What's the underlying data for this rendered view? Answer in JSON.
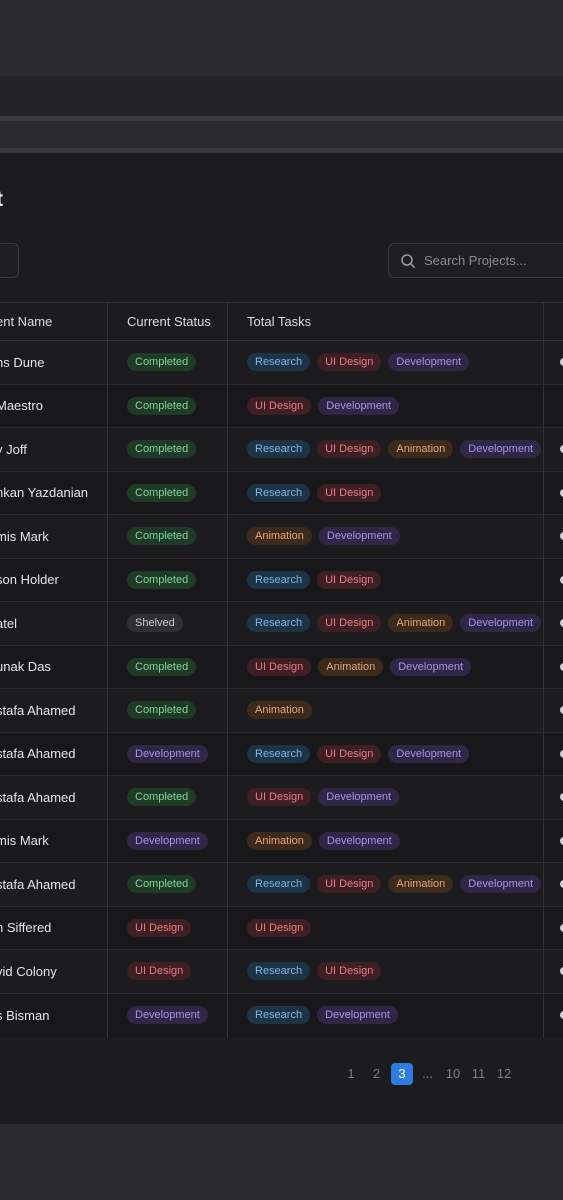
{
  "page": {
    "title": "t"
  },
  "search": {
    "placeholder": "Search Projects..."
  },
  "table": {
    "headers": {
      "name": "ent Name",
      "status": "Current Status",
      "tasks": "Total Tasks"
    },
    "rows": [
      {
        "name": "ns Dune",
        "status": "Completed",
        "tasks": [
          "Research",
          "UI Design",
          "Development"
        ]
      },
      {
        "name": "Maestro",
        "status": "Completed",
        "tasks": [
          "UI Design",
          "Development"
        ]
      },
      {
        "name": "y Joff",
        "status": "Completed",
        "tasks": [
          "Research",
          "UI Design",
          "Animation",
          "Development"
        ]
      },
      {
        "name": "nkan  Yazdanian",
        "status": "Completed",
        "tasks": [
          "Research",
          "UI Design"
        ]
      },
      {
        "name": "mis Mark",
        "status": "Completed",
        "tasks": [
          "Animation",
          "Development"
        ]
      },
      {
        "name": "son Holder",
        "status": "Completed",
        "tasks": [
          "Research",
          "UI Design"
        ]
      },
      {
        "name": "atel",
        "status": "Shelved",
        "tasks": [
          "Research",
          "UI Design",
          "Animation",
          "Development"
        ]
      },
      {
        "name": "unak Das",
        "status": "Completed",
        "tasks": [
          "UI Design",
          "Animation",
          "Development"
        ]
      },
      {
        "name": "stafa Ahamed",
        "status": "Completed",
        "tasks": [
          "Animation"
        ]
      },
      {
        "name": "stafa Ahamed",
        "status": "Development",
        "tasks": [
          "Research",
          "UI Design",
          "Development"
        ]
      },
      {
        "name": "stafa Ahamed",
        "status": "Completed",
        "tasks": [
          "UI Design",
          "Development"
        ]
      },
      {
        "name": "mis Mark",
        "status": "Development",
        "tasks": [
          "Animation",
          "Development"
        ]
      },
      {
        "name": "stafa Ahamed",
        "status": "Completed",
        "tasks": [
          "Research",
          "UI Design",
          "Animation",
          "Development"
        ]
      },
      {
        "name": "n Siffered",
        "status": "UI Design",
        "tasks": [
          "UI Design"
        ]
      },
      {
        "name": "vid Colony",
        "status": "UI Design",
        "tasks": [
          "Research",
          "UI Design"
        ]
      },
      {
        "name": "s Bisman",
        "status": "Development",
        "tasks": [
          "Research",
          "Development"
        ]
      }
    ],
    "row_dot": [
      true,
      false,
      true,
      true,
      true,
      true,
      true,
      true,
      true,
      true,
      true,
      true,
      true,
      true,
      true,
      true
    ]
  },
  "tag_colors": {
    "Completed": "#7fd49a",
    "Shelved": "#c8c8cc",
    "Development": "#a890ee",
    "UI Design": "#ec7a86",
    "Research": "#7db6ea",
    "Animation": "#e8a470"
  },
  "pagination": {
    "pages": [
      "1",
      "2",
      "3",
      "...",
      "10",
      "11",
      "12"
    ],
    "current": "3"
  }
}
